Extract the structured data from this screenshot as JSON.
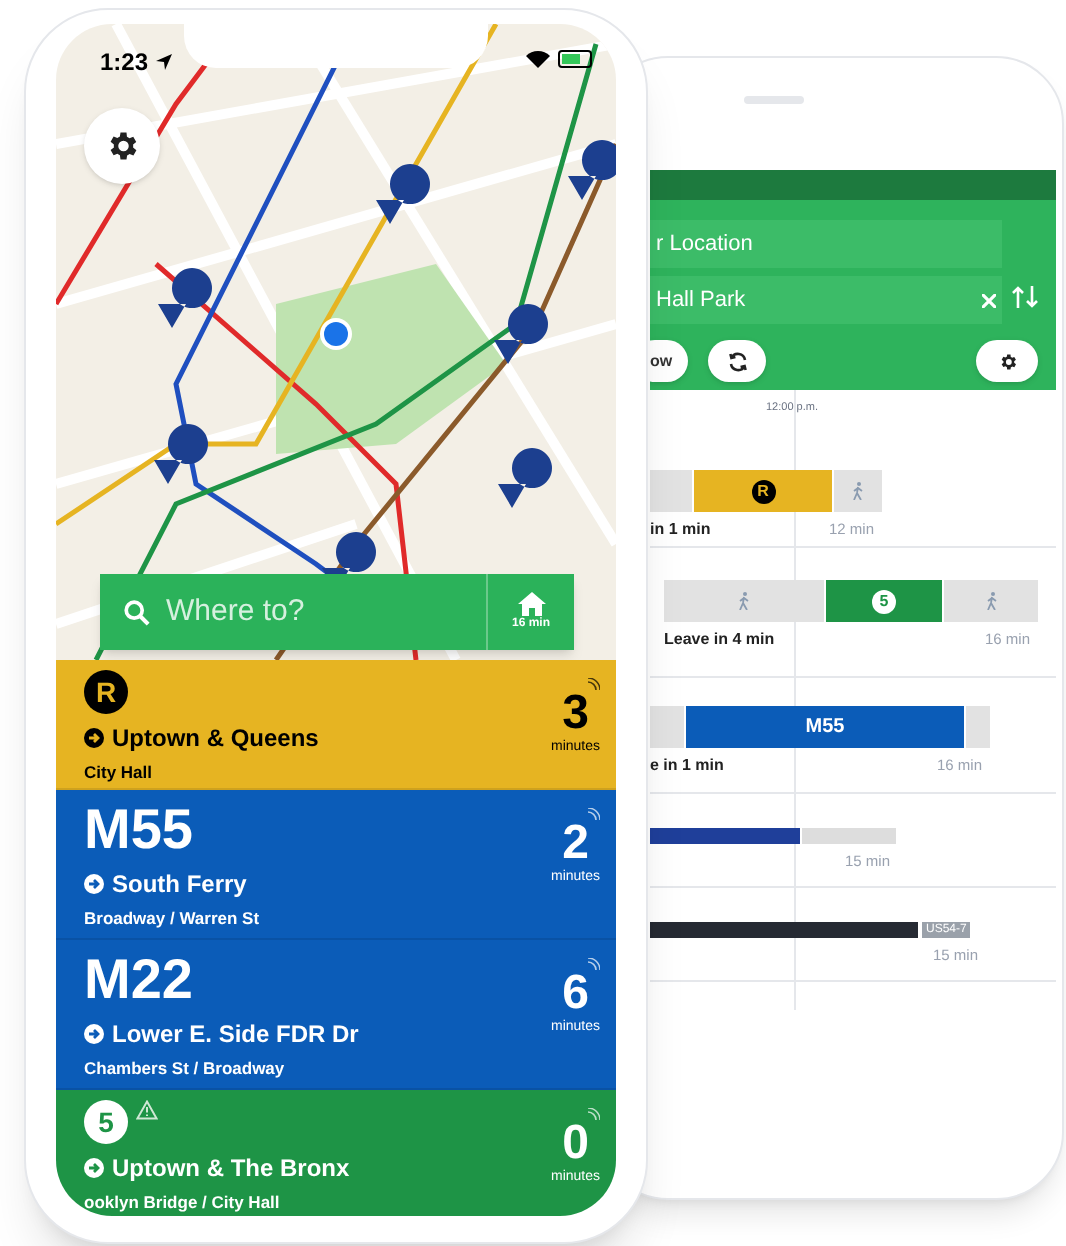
{
  "status_bar": {
    "time": "1:23"
  },
  "search": {
    "placeholder": "Where to?",
    "home_time": "16 min"
  },
  "departures": [
    {
      "kind": "subway",
      "route": "R",
      "color": "#e6b422",
      "direction": "Uptown & Queens",
      "stop": "City Hall",
      "minutes": "3",
      "unit": "minutes",
      "alert": false
    },
    {
      "kind": "bus",
      "route": "M55",
      "color": "#0b5cb8",
      "direction": "South Ferry",
      "stop": "Broadway / Warren St",
      "minutes": "2",
      "unit": "minutes",
      "alert": false
    },
    {
      "kind": "bus",
      "route": "M22",
      "color": "#0b5cb8",
      "direction": "Lower E. Side FDR Dr",
      "stop": "Chambers St / Broadway",
      "minutes": "6",
      "unit": "minutes",
      "alert": false
    },
    {
      "kind": "subway",
      "route": "5",
      "color": "#1e9446",
      "direction": "Uptown & The Bronx",
      "stop": "ooklyn Bridge / City Hall",
      "minutes": "0",
      "unit": "minutes",
      "alert": true
    }
  ],
  "planner": {
    "from": "r Location",
    "to": "Hall Park",
    "when": "ow",
    "time_marker": "12:00 p.m.",
    "trips": [
      {
        "segments": [
          {
            "kind": "wait"
          },
          {
            "kind": "train",
            "label": "R",
            "color": "#e6b422"
          },
          {
            "kind": "walk"
          }
        ],
        "leave": "in 1 min",
        "duration": "12 min"
      },
      {
        "segments": [
          {
            "kind": "walk"
          },
          {
            "kind": "train",
            "label": "5",
            "color": "#1e9446"
          },
          {
            "kind": "walk"
          }
        ],
        "leave": "Leave in 4 min",
        "duration": "16 min"
      },
      {
        "segments": [
          {
            "kind": "wait"
          },
          {
            "kind": "bus",
            "label": "M55",
            "color": "#0b5cb8"
          },
          {
            "kind": "wait"
          }
        ],
        "leave": "e in 1 min",
        "duration": "16 min"
      },
      {
        "segments": [
          {
            "kind": "thin",
            "color": "#1f3f9a"
          },
          {
            "kind": "thin",
            "color": "#dddddd"
          }
        ],
        "duration": "15 min"
      },
      {
        "segments": [
          {
            "kind": "thin",
            "color": "#262a33"
          },
          {
            "kind": "tag",
            "label": "US54-7"
          }
        ],
        "duration": "15 min"
      }
    ]
  }
}
